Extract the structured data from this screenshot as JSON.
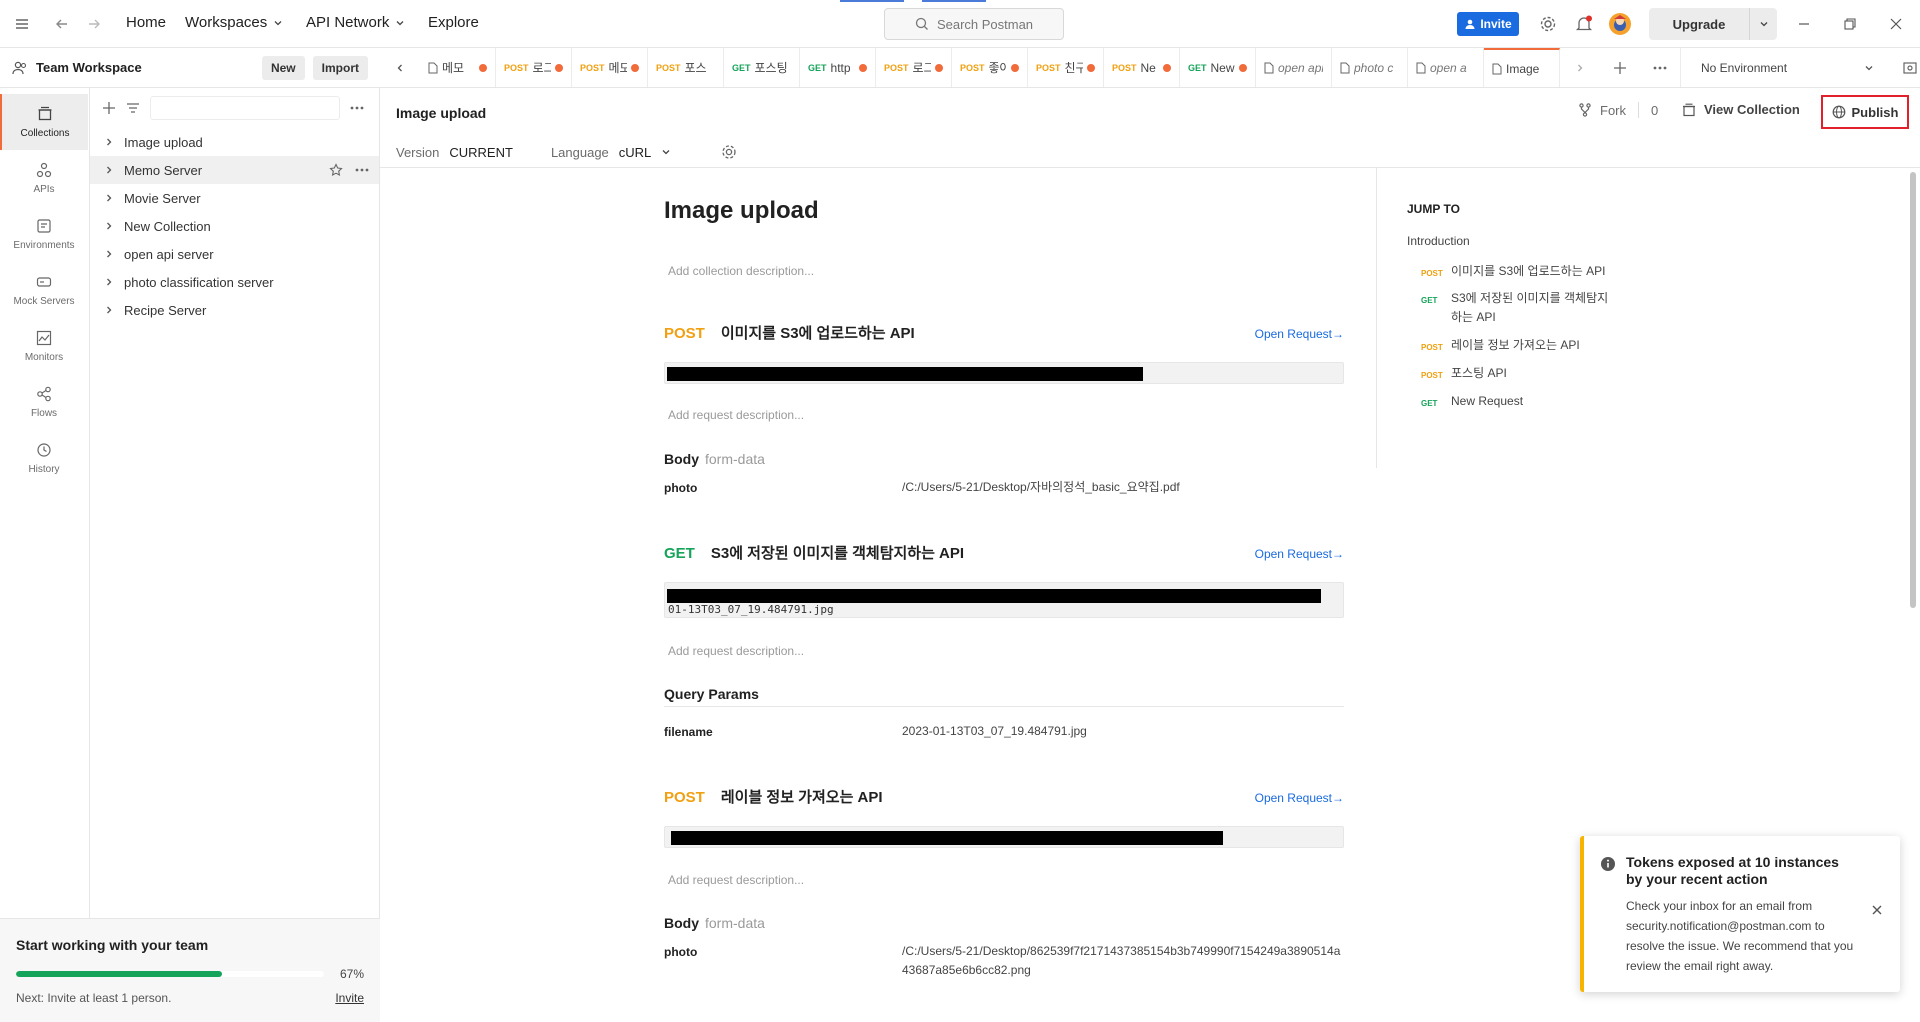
{
  "topbar": {
    "nav": {
      "home": "Home",
      "workspaces": "Workspaces",
      "api_network": "API Network",
      "explore": "Explore"
    },
    "search_placeholder": "Search Postman",
    "invite": "Invite",
    "upgrade": "Upgrade"
  },
  "workspace": {
    "name": "Team Workspace",
    "new_label": "New",
    "import_label": "Import"
  },
  "rail": [
    {
      "label": "Collections",
      "icon": "collections-icon"
    },
    {
      "label": "APIs",
      "icon": "apis-icon"
    },
    {
      "label": "Environments",
      "icon": "environments-icon"
    },
    {
      "label": "Mock Servers",
      "icon": "mock-servers-icon"
    },
    {
      "label": "Monitors",
      "icon": "monitors-icon"
    },
    {
      "label": "Flows",
      "icon": "flows-icon"
    },
    {
      "label": "History",
      "icon": "history-icon"
    }
  ],
  "collections": [
    {
      "name": "Image upload"
    },
    {
      "name": "Memo Server"
    },
    {
      "name": "Movie Server"
    },
    {
      "name": "New Collection"
    },
    {
      "name": "open api server"
    },
    {
      "name": "photo classification server"
    },
    {
      "name": "Recipe Server"
    }
  ],
  "team_card": {
    "title": "Start working with your team",
    "progress": 0.67,
    "progress_label": "67%",
    "next": "Next: Invite at least 1 person.",
    "invite_link": "Invite"
  },
  "tabs": [
    {
      "method": "",
      "name": "메모",
      "dot": true
    },
    {
      "method": "POST",
      "name": "로그",
      "dot": true
    },
    {
      "method": "POST",
      "name": "메모",
      "dot": true
    },
    {
      "method": "POST",
      "name": "포스",
      "dot": false
    },
    {
      "method": "GET",
      "name": "포스팅",
      "dot": false
    },
    {
      "method": "GET",
      "name": "http",
      "dot": true
    },
    {
      "method": "POST",
      "name": "로그",
      "dot": true
    },
    {
      "method": "POST",
      "name": "좋아",
      "dot": true
    },
    {
      "method": "POST",
      "name": "친구",
      "dot": true
    },
    {
      "method": "POST",
      "name": "Ne",
      "dot": true
    },
    {
      "method": "GET",
      "name": "New",
      "dot": true
    },
    {
      "method": "",
      "name": "open api",
      "dot": false,
      "italic": true
    },
    {
      "method": "",
      "name": "photo c",
      "dot": false,
      "italic": true
    },
    {
      "method": "",
      "name": "open a",
      "dot": false,
      "italic": true
    },
    {
      "method": "",
      "name": "Image",
      "dot": false,
      "active": true
    }
  ],
  "environment": "No Environment",
  "workbench": {
    "title": "Image upload",
    "version_label": "Version",
    "version_value": "CURRENT",
    "language_label": "Language",
    "language_value": "cURL",
    "fork_label": "Fork",
    "fork_count": "0",
    "view_collection": "View Collection",
    "publish": "Publish"
  },
  "doc": {
    "title": "Image upload",
    "collection_desc_placeholder": "Add collection description...",
    "request_desc_placeholder": "Add request description...",
    "open_request": "Open Request→",
    "requests": [
      {
        "method": "POST",
        "name": "이미지를 S3에 업로드하는 API",
        "url_text": "",
        "section_label": "Body",
        "section_sub": "form-data",
        "params": [
          {
            "key": "photo",
            "value": "/C:/Users/5-21/Desktop/자바의정석_basic_요약집.pdf"
          }
        ]
      },
      {
        "method": "GET",
        "name": "S3에 저장된 이미지를 객체탐지하는 API",
        "url_text": "01-13T03_07_19.484791.jpg",
        "section_label": "Query Params",
        "section_sub": "",
        "params": [
          {
            "key": "filename",
            "value": "2023-01-13T03_07_19.484791.jpg"
          }
        ]
      },
      {
        "method": "POST",
        "name": "레이블 정보 가져오는 API",
        "url_text": "",
        "section_label": "Body",
        "section_sub": "form-data",
        "params": [
          {
            "key": "photo",
            "value": "/C:/Users/5-21/Desktop/862539f7f2171437385154b3b749990f7154249a3890514a43687a85e6b6cc82.png"
          }
        ]
      }
    ]
  },
  "jump_to": {
    "header": "JUMP TO",
    "intro": "Introduction",
    "items": [
      {
        "method": "POST",
        "name": "이미지를 S3에 업로드하는 API"
      },
      {
        "method": "GET",
        "name": "S3에 저장된 이미지를 객체탐지하는 API"
      },
      {
        "method": "POST",
        "name": "레이블 정보 가져오는 API"
      },
      {
        "method": "POST",
        "name": "포스팅 API"
      },
      {
        "method": "GET",
        "name": "New Request"
      }
    ]
  },
  "toast": {
    "title": "Tokens exposed at 10 instances by your recent action",
    "body": "Check your inbox for an email from security.notification@postman.com to resolve the issue. We recommend that you review the email right away."
  },
  "colors": {
    "post": "#f0a010",
    "get": "#16a35a",
    "accent": "#f26b3a",
    "link": "#1a6be0",
    "warning": "#f7b500"
  }
}
